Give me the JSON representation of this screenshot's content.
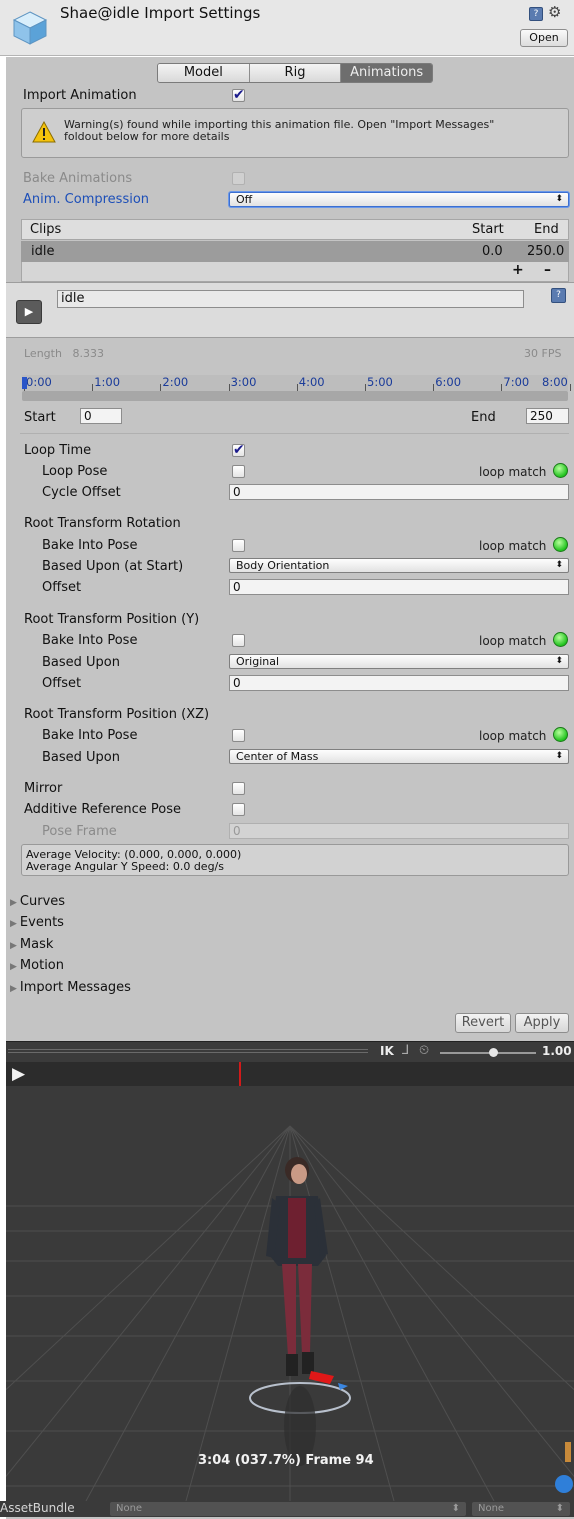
{
  "header": {
    "title": "Shae@idle Import Settings",
    "open_label": "Open",
    "help_icon": "help-book-icon",
    "settings_icon": "gear-icon"
  },
  "tabs": [
    {
      "label": "Model",
      "active": false
    },
    {
      "label": "Rig",
      "active": false
    },
    {
      "label": "Animations",
      "active": true
    }
  ],
  "import_animation": {
    "label": "Import Animation",
    "checked": true
  },
  "warning": {
    "line1": "Warning(s) found while importing this animation file. Open \"Import Messages\"",
    "line2": "foldout below for more details",
    "icon": "warning-triangle-icon"
  },
  "bake_animations": {
    "label": "Bake Animations",
    "checked": false
  },
  "anim_compression": {
    "label": "Anim. Compression",
    "value": "Off"
  },
  "clips_table": {
    "headers": {
      "name": "Clips",
      "start": "Start",
      "end": "End"
    },
    "rows": [
      {
        "name": "idle",
        "start": "0.0",
        "end": "250.0"
      }
    ],
    "add_label": "+",
    "remove_label": "–"
  },
  "clip": {
    "name": "idle",
    "play_icon": "play-icon"
  },
  "timeline": {
    "length_label": "Length",
    "length_value": "8.333",
    "fps": "30 FPS",
    "ticks": [
      "0:00",
      "1:00",
      "2:00",
      "3:00",
      "4:00",
      "5:00",
      "6:00",
      "7:00",
      "8:00"
    ]
  },
  "range": {
    "start_label": "Start",
    "start_value": "0",
    "end_label": "End",
    "end_value": "250"
  },
  "loop_time": {
    "label": "Loop Time",
    "checked": true
  },
  "loop_pose": {
    "label": "Loop Pose",
    "checked": false
  },
  "cycle_offset": {
    "label": "Cycle Offset",
    "value": "0"
  },
  "loop_match_label": "loop match",
  "root_rotation": {
    "title": "Root Transform Rotation",
    "bake_label": "Bake Into Pose",
    "based_label": "Based Upon (at Start)",
    "based_value": "Body Orientation",
    "offset_label": "Offset",
    "offset_value": "0"
  },
  "root_position_y": {
    "title": "Root Transform Position (Y)",
    "bake_label": "Bake Into Pose",
    "based_label": "Based Upon",
    "based_value": "Original",
    "offset_label": "Offset",
    "offset_value": "0"
  },
  "root_position_xz": {
    "title": "Root Transform Position (XZ)",
    "bake_label": "Bake Into Pose",
    "based_label": "Based Upon",
    "based_value": "Center of Mass"
  },
  "mirror": {
    "label": "Mirror",
    "checked": false
  },
  "additive": {
    "label": "Additive Reference Pose",
    "checked": false
  },
  "pose_frame": {
    "label": "Pose Frame",
    "value": "0"
  },
  "stats": {
    "velocity": "Average Velocity: (0.000, 0.000, 0.000)",
    "angular": "Average Angular Y Speed: 0.0 deg/s"
  },
  "foldouts": [
    "Curves",
    "Events",
    "Mask",
    "Motion",
    "Import Messages"
  ],
  "actions": {
    "revert": "Revert",
    "apply": "Apply"
  },
  "preview": {
    "ik_label": "IK",
    "speed_value": "1.00",
    "speed_fraction": 0.55,
    "playhead_fraction": 0.377,
    "status": "3:04 (037.7%) Frame 94"
  },
  "asset_bundle": {
    "label": "AssetBundle",
    "name_value": "None",
    "variant_value": "None"
  },
  "colors": {
    "panel": "#c4c4c4",
    "link_blue": "#1d4fb8",
    "loop_match_green": "#22c31f",
    "viewport": "#3a3a3a",
    "playhead_red": "#d11a1a"
  }
}
